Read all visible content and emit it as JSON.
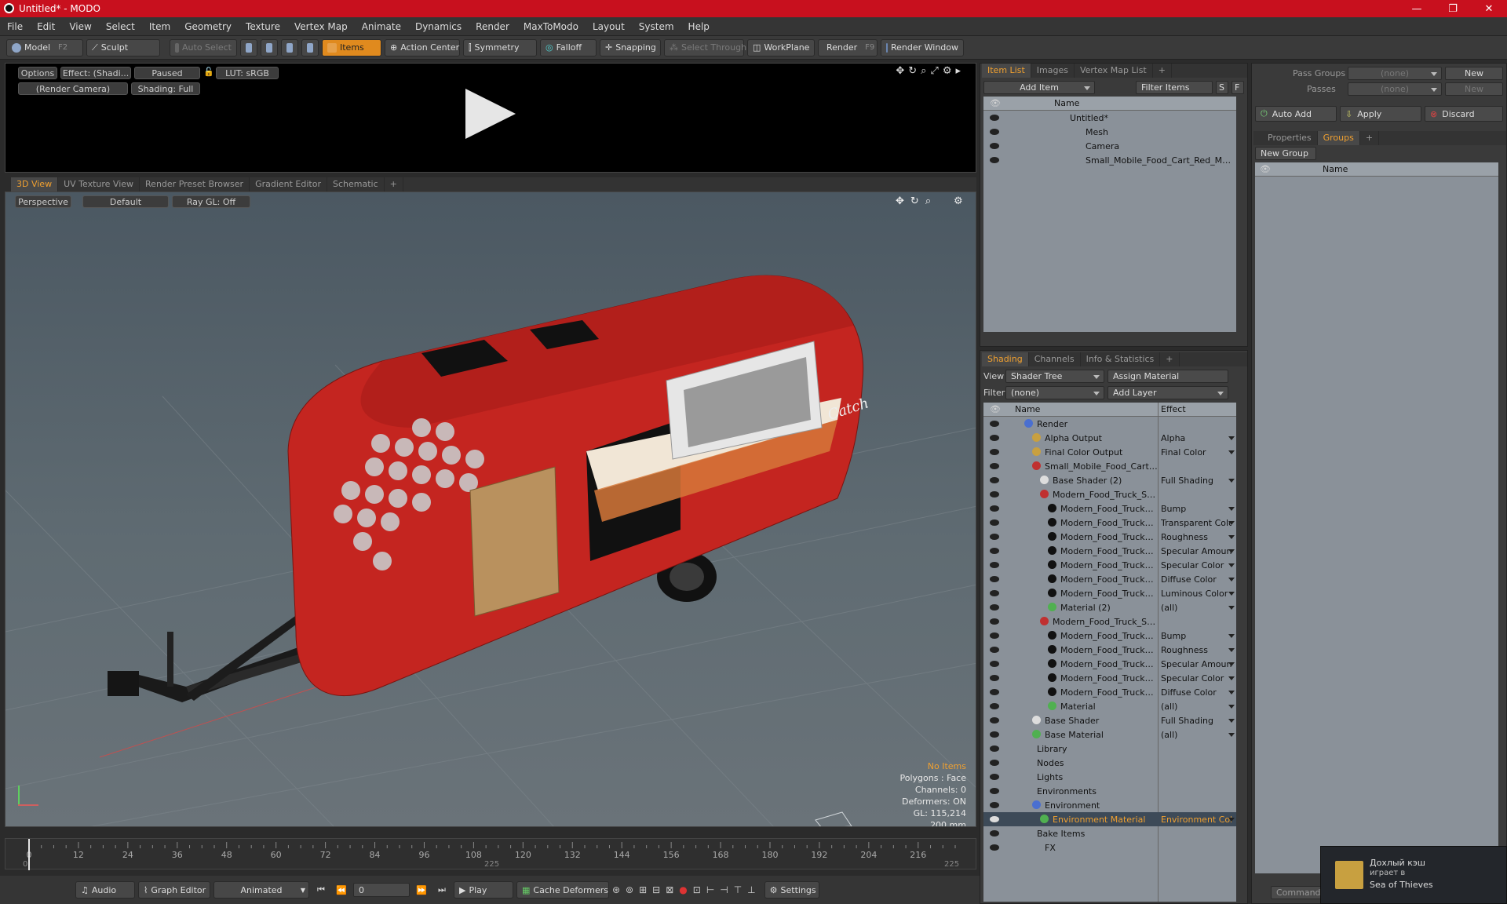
{
  "window": {
    "title": "Untitled* - MODO",
    "minimize": "—",
    "maximize": "❐",
    "close": "✕"
  },
  "menu": [
    "File",
    "Edit",
    "View",
    "Select",
    "Item",
    "Geometry",
    "Texture",
    "Vertex Map",
    "Animate",
    "Dynamics",
    "Render",
    "MaxToModo",
    "Layout",
    "System",
    "Help"
  ],
  "toolbar": {
    "model": "Model",
    "model_key": "F2",
    "sculpt": "Sculpt",
    "auto_select": "Auto Select",
    "items": "Items",
    "action_center": "Action Center",
    "symmetry": "Symmetry",
    "falloff": "Falloff",
    "snapping": "Snapping",
    "select_through": "Select Through",
    "workplane": "WorkPlane",
    "render": "Render",
    "render_key": "F9",
    "render_window": "Render Window"
  },
  "preview": {
    "options": "Options",
    "effect": "Effect: (Shadi...",
    "paused": "Paused",
    "lut": "LUT: sRGB",
    "camera": "(Render Camera)",
    "shading": "Shading: Full"
  },
  "view_tabs": [
    "3D View",
    "UV Texture View",
    "Render Preset Browser",
    "Gradient Editor",
    "Schematic",
    "+"
  ],
  "viewport": {
    "perspective": "Perspective",
    "default": "Default",
    "raygl": "Ray GL: Off",
    "info": {
      "no_items": "No Items",
      "polygons": "Polygons : Face",
      "channels": "Channels: 0",
      "deformers": "Deformers: ON",
      "gl": "GL: 115,214",
      "size": "200 mm"
    }
  },
  "timeline": {
    "ticks": [
      0,
      12,
      24,
      36,
      48,
      60,
      72,
      84,
      96,
      108,
      120,
      132,
      144,
      156,
      168,
      180,
      192,
      204,
      216
    ],
    "range_start": "0",
    "range_mid": "225",
    "range_end": "225"
  },
  "bottom": {
    "audio": "Audio",
    "graph_editor": "Graph Editor",
    "animated": "Animated",
    "frame": "0",
    "play": "Play",
    "cache": "Cache Deformers",
    "settings": "Settings"
  },
  "item_list": {
    "tabs": [
      "Item List",
      "Images",
      "Vertex Map List",
      "+"
    ],
    "add_item": "Add Item",
    "filter": "Filter Items",
    "s": "S",
    "f": "F",
    "col_name": "Name",
    "rows": [
      {
        "name": "Untitled*",
        "indent": 94
      },
      {
        "name": "Mesh",
        "indent": 114
      },
      {
        "name": "Camera",
        "indent": 114
      },
      {
        "name": "Small_Mobile_Food_Cart_Red_Mocku ...",
        "indent": 114
      }
    ]
  },
  "shading": {
    "tabs": [
      "Shading",
      "Channels",
      "Info & Statistics",
      "+"
    ],
    "view_label": "View",
    "view_value": "Shader Tree",
    "assign_material": "Assign Material",
    "filter_label": "Filter",
    "filter_value": "(none)",
    "add_layer": "Add Layer",
    "col_name": "Name",
    "col_effect": "Effect",
    "rows": [
      {
        "name": "Render",
        "effect": "",
        "indent": 52,
        "color": "#4a6fd0"
      },
      {
        "name": "Alpha Output",
        "effect": "Alpha",
        "indent": 62,
        "color": "#c8a040"
      },
      {
        "name": "Final Color Output",
        "effect": "Final Color",
        "indent": 62,
        "color": "#c8a040"
      },
      {
        "name": "Small_Mobile_Food_Cart_ ...",
        "effect": "",
        "indent": 62,
        "color": "#c03030"
      },
      {
        "name": "Base Shader (2)",
        "effect": "Full Shading",
        "indent": 72,
        "color": "#dddddd"
      },
      {
        "name": "Modern_Food_Truck_Sm...",
        "effect": "",
        "indent": 72,
        "color": "#c03030"
      },
      {
        "name": "Modern_Food_Truck_ ...",
        "effect": "Bump",
        "indent": 82,
        "color": "#111111"
      },
      {
        "name": "Modern_Food_Truck_ ...",
        "effect": "Transparent Color",
        "indent": 82,
        "color": "#111111"
      },
      {
        "name": "Modern_Food_Truck_ ...",
        "effect": "Roughness",
        "indent": 82,
        "color": "#111111"
      },
      {
        "name": "Modern_Food_Truck_ ...",
        "effect": "Specular Amount",
        "indent": 82,
        "color": "#111111"
      },
      {
        "name": "Modern_Food_Truck_ ...",
        "effect": "Specular Color",
        "indent": 82,
        "color": "#111111"
      },
      {
        "name": "Modern_Food_Truck_ ...",
        "effect": "Diffuse Color",
        "indent": 82,
        "color": "#111111"
      },
      {
        "name": "Modern_Food_Truck_ ...",
        "effect": "Luminous Color",
        "indent": 82,
        "color": "#111111"
      },
      {
        "name": "Material (2)",
        "effect": "(all)",
        "indent": 82,
        "color": "#50b050"
      },
      {
        "name": "Modern_Food_Truck_Sm...",
        "effect": "",
        "indent": 72,
        "color": "#c03030"
      },
      {
        "name": "Modern_Food_Truck_ ...",
        "effect": "Bump",
        "indent": 82,
        "color": "#111111"
      },
      {
        "name": "Modern_Food_Truck_ ...",
        "effect": "Roughness",
        "indent": 82,
        "color": "#111111"
      },
      {
        "name": "Modern_Food_Truck_ ...",
        "effect": "Specular Amount",
        "indent": 82,
        "color": "#111111"
      },
      {
        "name": "Modern_Food_Truck_ ...",
        "effect": "Specular Color",
        "indent": 82,
        "color": "#111111"
      },
      {
        "name": "Modern_Food_Truck_ ...",
        "effect": "Diffuse Color",
        "indent": 82,
        "color": "#111111"
      },
      {
        "name": "Material",
        "effect": "(all)",
        "indent": 82,
        "color": "#50b050"
      },
      {
        "name": "Base Shader",
        "effect": "Full Shading",
        "indent": 62,
        "color": "#dddddd"
      },
      {
        "name": "Base Material",
        "effect": "(all)",
        "indent": 62,
        "color": "#50b050"
      },
      {
        "name": "Library",
        "effect": "",
        "indent": 52,
        "color": ""
      },
      {
        "name": "Nodes",
        "effect": "",
        "indent": 52,
        "color": ""
      },
      {
        "name": "Lights",
        "effect": "",
        "indent": 52,
        "color": ""
      },
      {
        "name": "Environments",
        "effect": "",
        "indent": 52,
        "color": ""
      },
      {
        "name": "Environment",
        "effect": "",
        "indent": 62,
        "color": "#4a6fd0"
      },
      {
        "name": "Environment Material",
        "effect": "Environment Color",
        "indent": 72,
        "color": "#50b050",
        "selected": true
      },
      {
        "name": "Bake Items",
        "effect": "",
        "indent": 52,
        "color": ""
      },
      {
        "name": "FX",
        "effect": "",
        "indent": 62,
        "color": ""
      }
    ]
  },
  "right": {
    "pass_groups": "Pass Groups",
    "pass_groups_value": "(none)",
    "new": "New",
    "passes": "Passes",
    "passes_value": "(none)",
    "new2": "New",
    "auto_add": "Auto Add",
    "apply": "Apply",
    "discard": "Discard",
    "tabs": [
      "Properties",
      "Groups",
      "+"
    ],
    "new_group": "New Group",
    "col_name": "Name",
    "command": "Command"
  },
  "notification": {
    "line1": "Дохлый кэш",
    "line2": "играет в",
    "line3": "Sea of Thieves"
  },
  "colors": {
    "accent": "#f0a030",
    "title": "#c8101e",
    "trailer": "#c42520"
  }
}
